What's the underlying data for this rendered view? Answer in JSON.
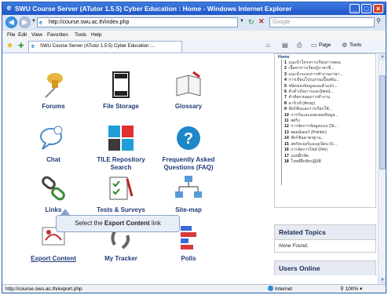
{
  "window": {
    "title": "SWU Course Server (ATutor 1.5.5) Cyber Education : Home - Windows Internet Explorer"
  },
  "address_bar": {
    "url": "http://course.swu.ac.th/index.php",
    "search_placeholder": "Google"
  },
  "menu": {
    "items": [
      "File",
      "Edit",
      "View",
      "Favorites",
      "Tools",
      "Help"
    ]
  },
  "tab": {
    "label": "SWU Course Server (ATutor 1.5.5) Cyber Education :..."
  },
  "toolbar": {
    "page_label": "Page",
    "tools_label": "Tools"
  },
  "tools": [
    {
      "label": "Forums",
      "icon": "pushpin-icon"
    },
    {
      "label": "File Storage",
      "icon": "file-storage-icon"
    },
    {
      "label": "Glossary",
      "icon": "glossary-book-icon"
    },
    {
      "label": "Chat",
      "icon": "chat-bubble-icon"
    },
    {
      "label": "TILE Repository Search",
      "icon": "tile-repository-icon"
    },
    {
      "label": "Frequently Asked Questions (FAQ)",
      "icon": "faq-question-icon"
    },
    {
      "label": "Links",
      "icon": "chain-links-icon"
    },
    {
      "label": "Tests & Surveys",
      "icon": "tests-surveys-icon"
    },
    {
      "label": "Site-map",
      "icon": "sitemap-icon"
    },
    {
      "label": "Export Content",
      "icon": "export-content-icon"
    },
    {
      "label": "My Tracker",
      "icon": "my-tracker-icon"
    },
    {
      "label": "Polls",
      "icon": "polls-chart-icon"
    }
  ],
  "navtree": {
    "home": "Home",
    "items": [
      {
        "num": "1",
        "text": "แนะนำโครงการเรียนการสอน"
      },
      {
        "num": "2",
        "text": "เนื้อหาการเรียนรู้ภาษาซี..."
      },
      {
        "num": "3",
        "text": "แนะนำระบบการทำงานภาษา..."
      },
      {
        "num": "4",
        "text": "การเขียนโปรแกรมเบื้องต้น..."
      },
      {
        "num": "5",
        "text": "ชนิดของข้อมูลและตัวแปร..."
      },
      {
        "num": "6",
        "text": "ตัวดำเนินการและนิพจน์..."
      },
      {
        "num": "7",
        "text": "คำสั่งควบคุมการทำงาน"
      },
      {
        "num": "8",
        "text": "อาร์เรย์ (Array)"
      },
      {
        "num": "9",
        "text": "ฟังก์ชันและการเรียกใช้..."
      },
      {
        "num": "10",
        "text": "การรับและแสดงผลข้อมูล..."
      },
      {
        "num": "11",
        "text": "สตริง"
      },
      {
        "num": "12",
        "text": "การจัดการข้อมูลแบบ (St..."
      },
      {
        "num": "13",
        "text": "พอยน์เตอร์ (Pointer)"
      },
      {
        "num": "14",
        "text": "ฟังก์ชันมาตรฐาน..."
      },
      {
        "num": "15",
        "text": "สตรัคเจอร์และยูเนียน (S..."
      },
      {
        "num": "16",
        "text": "การจัดการไฟล์ (File)"
      },
      {
        "num": "17",
        "text": "แบบฝึกหัด"
      },
      {
        "num": "18",
        "text": "โจทย์ฝึกหัดปฏิบัติ"
      }
    ]
  },
  "related_topics": {
    "title": "Related Topics",
    "body": "None Found."
  },
  "users_online": {
    "title": "Users Online"
  },
  "callout": {
    "prefix": "Select the ",
    "strong": "Export Content",
    "suffix": " link"
  },
  "status": {
    "url": "http://course.swu.ac.th/export.php",
    "zone": "Internet",
    "zoom": "100%"
  }
}
